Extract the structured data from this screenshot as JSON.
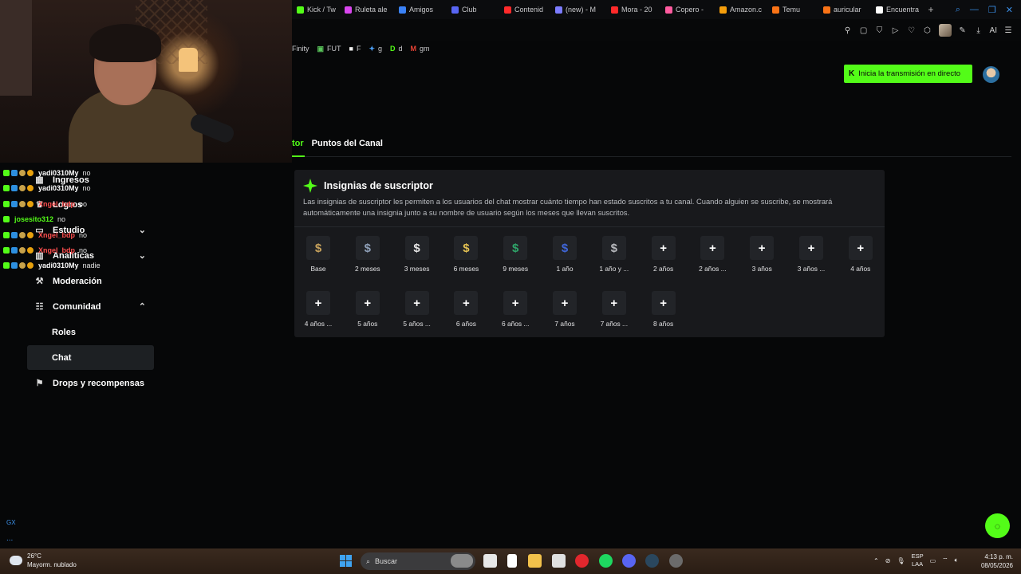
{
  "browser": {
    "tabs": [
      {
        "label": "Kick / Tw",
        "icon": "kick-icon",
        "color": "#53fc18"
      },
      {
        "label": "Ruleta ale",
        "icon": "ruleta-icon",
        "color": "#d946ef"
      },
      {
        "label": "Amigos",
        "icon": "amigos-icon",
        "color": "#3b82f6"
      },
      {
        "label": "Club",
        "icon": "club-icon",
        "color": "#5865f2"
      },
      {
        "label": "Contenid",
        "icon": "youtube-icon",
        "color": "#ff2a2a"
      },
      {
        "label": "(new) - M",
        "icon": "new-icon",
        "color": "#7c7cff"
      },
      {
        "label": "Mora - 20",
        "icon": "youtube-icon",
        "color": "#ff2a2a"
      },
      {
        "label": "Copero -",
        "icon": "copero-icon",
        "color": "#ff5b9f"
      },
      {
        "label": "Amazon.c",
        "icon": "amazon-icon",
        "color": "#f59e0b"
      },
      {
        "label": "Temu",
        "icon": "temu-icon",
        "color": "#f97316"
      },
      {
        "label": "auricular",
        "icon": "temu-icon",
        "color": "#f97316"
      },
      {
        "label": "Encuentra",
        "icon": "tiktok-icon",
        "color": "#ffffff"
      }
    ],
    "new_tab_label": "+",
    "toolbar_ai_label": "AI",
    "bookmarks": [
      {
        "label": "Finity",
        "glyph": ""
      },
      {
        "label": "FUT",
        "glyph": "▣",
        "color": "#59c45a"
      },
      {
        "label": "F",
        "glyph": "■",
        "color": "#f2f2f2"
      },
      {
        "label": "g",
        "glyph": "✦",
        "color": "#4a9cf0"
      },
      {
        "label": "d",
        "glyph": "D",
        "color": "#53fc18"
      },
      {
        "label": "gm",
        "glyph": "M",
        "color": "#ea4335"
      }
    ]
  },
  "header": {
    "go_live_label": "Inicia la transmisión en directo",
    "go_live_icon": "K"
  },
  "page_tabs": {
    "active": "tor",
    "other": "Puntos del Canal"
  },
  "sidebar": {
    "items": [
      {
        "label": "Ingresos",
        "icon": "▦",
        "chev": "",
        "sub": false,
        "selected": false
      },
      {
        "label": "Logros",
        "icon": "♛",
        "chev": "",
        "sub": false,
        "selected": false
      },
      {
        "label": "Estudio",
        "icon": "▭",
        "chev": "⌄",
        "sub": false,
        "selected": false
      },
      {
        "label": "Analíticas",
        "icon": "▥",
        "chev": "⌄",
        "sub": false,
        "selected": false
      },
      {
        "label": "Moderación",
        "icon": "⚒",
        "chev": "",
        "sub": false,
        "selected": false
      },
      {
        "label": "Comunidad",
        "icon": "☷",
        "chev": "⌃",
        "sub": false,
        "selected": false
      },
      {
        "label": "Roles",
        "icon": "",
        "chev": "",
        "sub": true,
        "selected": false
      },
      {
        "label": "Chat",
        "icon": "",
        "chev": "",
        "sub": true,
        "selected": true
      },
      {
        "label": "Drops y recompensas",
        "icon": "⚑",
        "chev": "",
        "sub": false,
        "selected": false
      }
    ]
  },
  "chat": {
    "lines": [
      {
        "user": "yadi0310My",
        "color": "#ffffff",
        "msg": "no"
      },
      {
        "user": "yadi0310My",
        "color": "#ffffff",
        "msg": "no"
      },
      {
        "user": "Xngel_bdp",
        "color": "#ff4f4f",
        "msg": "oo"
      },
      {
        "user": "josesito312",
        "color": "#53fc18",
        "msg": "no"
      },
      {
        "user": "Xngel_bdp",
        "color": "#ff4f4f",
        "msg": "no"
      },
      {
        "user": "Xngel_bdp",
        "color": "#ff4f4f",
        "msg": "no"
      },
      {
        "user": "yadi0310My",
        "color": "#ffffff",
        "msg": "nadie"
      }
    ],
    "gx_label": "GX",
    "dots_label": "..."
  },
  "card": {
    "title": "Insignias de suscriptor",
    "description": "Las insignias de suscriptor les permiten a los usuarios del chat mostrar cuánto tiempo han estado suscritos a tu canal. Cuando alguien se suscribe, se mostrará automáticamente una insignia junto a su nombre de usuario según los meses que llevan suscritos.",
    "badges": [
      {
        "label": "Base",
        "glyph": "$",
        "color": "#c7a25c",
        "filled": true
      },
      {
        "label": "2 meses",
        "glyph": "$",
        "color": "#8fa0b8",
        "filled": true
      },
      {
        "label": "3 meses",
        "glyph": "$",
        "color": "#e5e5e5",
        "filled": true
      },
      {
        "label": "6 meses",
        "glyph": "$",
        "color": "#e3c152",
        "filled": true
      },
      {
        "label": "9 meses",
        "glyph": "$",
        "color": "#2fa56a",
        "filled": true
      },
      {
        "label": "1 año",
        "glyph": "$",
        "color": "#3f66d8",
        "filled": true
      },
      {
        "label": "1 año y ...",
        "glyph": "$",
        "color": "#b7b9bd",
        "filled": true
      },
      {
        "label": "2 años",
        "glyph": "+",
        "color": "#ffffff",
        "filled": false
      },
      {
        "label": "2 años ...",
        "glyph": "+",
        "color": "#ffffff",
        "filled": false
      },
      {
        "label": "3 años",
        "glyph": "+",
        "color": "#ffffff",
        "filled": false
      },
      {
        "label": "3 años ...",
        "glyph": "+",
        "color": "#ffffff",
        "filled": false
      },
      {
        "label": "4 años",
        "glyph": "+",
        "color": "#ffffff",
        "filled": false
      },
      {
        "label": "4 años ...",
        "glyph": "+",
        "color": "#ffffff",
        "filled": false
      },
      {
        "label": "5 años",
        "glyph": "+",
        "color": "#ffffff",
        "filled": false
      },
      {
        "label": "5 años ...",
        "glyph": "+",
        "color": "#ffffff",
        "filled": false
      },
      {
        "label": "6 años",
        "glyph": "+",
        "color": "#ffffff",
        "filled": false
      },
      {
        "label": "6 años ...",
        "glyph": "+",
        "color": "#ffffff",
        "filled": false
      },
      {
        "label": "7 años",
        "glyph": "+",
        "color": "#ffffff",
        "filled": false
      },
      {
        "label": "7 años ...",
        "glyph": "+",
        "color": "#ffffff",
        "filled": false
      },
      {
        "label": "8 años",
        "glyph": "+",
        "color": "#ffffff",
        "filled": false
      }
    ]
  },
  "taskbar": {
    "temperature": "26°C",
    "weather": "Mayorm. nublado",
    "search_label": "Buscar",
    "lang_top": "ESP",
    "lang_bottom": "LAA",
    "time": "4:13 p. m.",
    "date": "08/05/2026"
  },
  "colors": {
    "accent": "#53fc18",
    "card_bg": "#18191c",
    "page_bg": "#060708"
  }
}
